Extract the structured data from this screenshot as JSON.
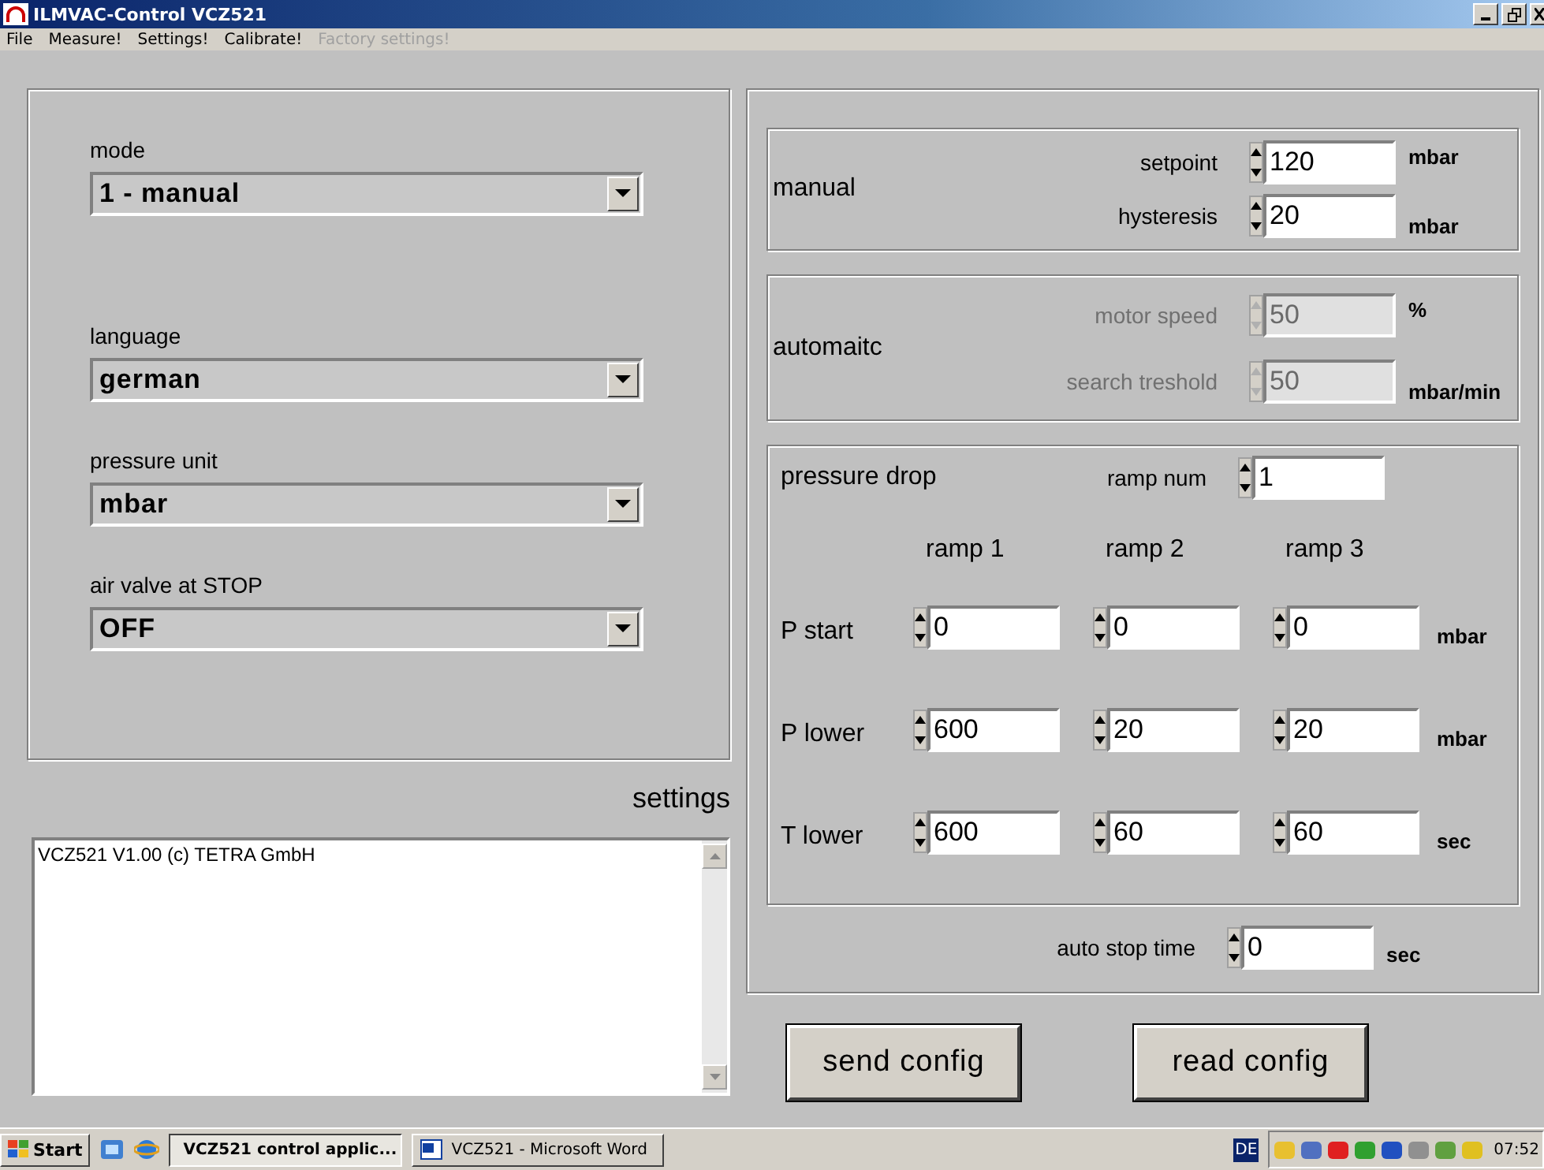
{
  "window": {
    "title": "ILMVAC-Control VCZ521"
  },
  "menu": [
    {
      "label": "File",
      "disabled": false
    },
    {
      "label": "Measure!",
      "disabled": false
    },
    {
      "label": "Settings!",
      "disabled": false
    },
    {
      "label": "Calibrate!",
      "disabled": false
    },
    {
      "label": "Factory settings!",
      "disabled": true
    }
  ],
  "settings": {
    "fields": [
      {
        "label": "mode",
        "value": "1 - manual"
      },
      {
        "label": "language",
        "value": "german"
      },
      {
        "label": "pressure unit",
        "value": "mbar"
      },
      {
        "label": "air valve at STOP",
        "value": "OFF"
      }
    ],
    "title": "settings",
    "log": "VCZ521 V1.00 (c) TETRA GmbH"
  },
  "manual": {
    "title": "manual",
    "rows": [
      {
        "label": "setpoint",
        "value": "120",
        "unit": "mbar",
        "disabled": false
      },
      {
        "label": "hysteresis",
        "value": "20",
        "unit": "mbar",
        "disabled": false
      }
    ]
  },
  "automatic": {
    "title": "automaitc",
    "rows": [
      {
        "label": "motor speed",
        "value": "50",
        "unit": "%",
        "disabled": true
      },
      {
        "label": "search treshold",
        "value": "50",
        "unit": "mbar/min",
        "disabled": true
      }
    ]
  },
  "pressure_drop": {
    "title": "pressure drop",
    "ramp_num": {
      "label": "ramp num",
      "value": "1"
    },
    "columns": [
      "ramp 1",
      "ramp 2",
      "ramp 3"
    ],
    "rows": [
      {
        "label": "P start",
        "values": [
          "0",
          "0",
          "0"
        ],
        "unit": "mbar"
      },
      {
        "label": "P lower",
        "values": [
          "600",
          "20",
          "20"
        ],
        "unit": "mbar"
      },
      {
        "label": "T lower",
        "values": [
          "600",
          "60",
          "60"
        ],
        "unit": "sec"
      }
    ]
  },
  "auto_stop": {
    "label": "auto stop time",
    "value": "0",
    "unit": "sec"
  },
  "buttons": [
    "send config",
    "read config"
  ],
  "taskbar": {
    "start": "Start",
    "tasks": [
      {
        "label": "VCZ521 control applic...",
        "selected": true
      },
      {
        "label": "VCZ521 - Microsoft Word",
        "selected": false
      }
    ],
    "language": "DE",
    "time": "07:52"
  }
}
